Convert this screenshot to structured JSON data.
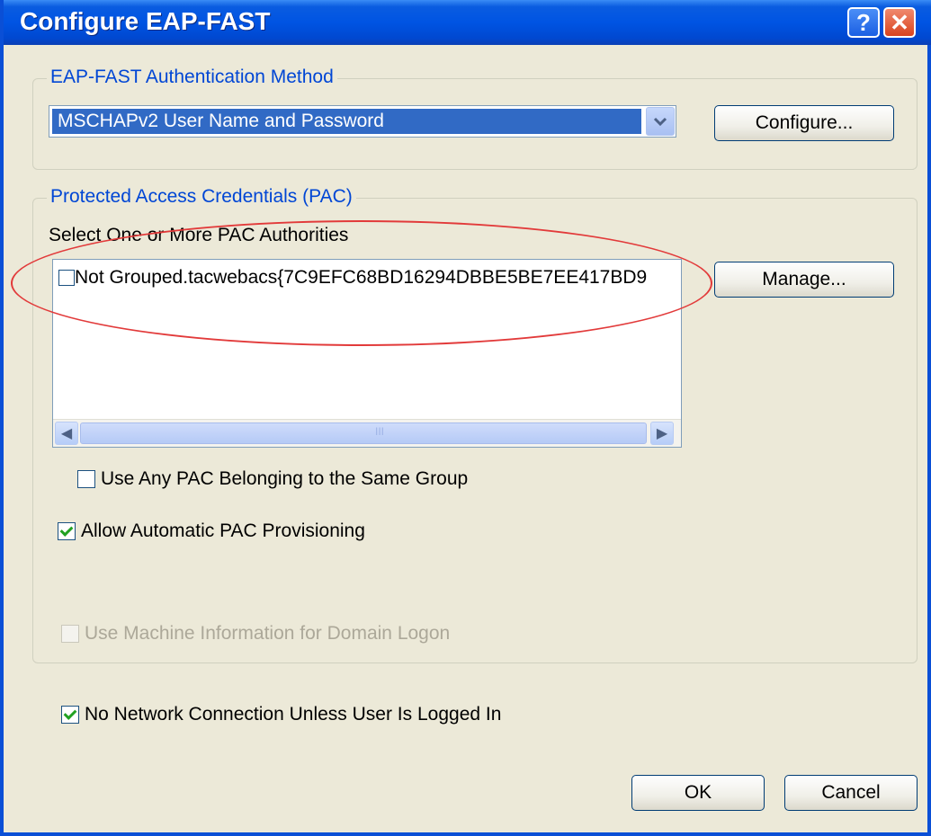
{
  "window": {
    "title": "Configure EAP-FAST",
    "help_icon": "help-icon",
    "close_icon": "close-icon"
  },
  "auth_group": {
    "legend": "EAP-FAST Authentication Method",
    "selected_method": "MSCHAPv2 User Name and Password",
    "configure_button": "Configure..."
  },
  "pac_group": {
    "legend": "Protected Access Credentials (PAC)",
    "select_label": "Select One or More PAC Authorities",
    "pac_items": [
      {
        "label": "Not Grouped.tacwebacs{7C9EFC68BD16294DBBE5BE7EE417BD9",
        "checked": false
      }
    ],
    "manage_button": "Manage...",
    "scroll_thumb_grip": "III",
    "use_any_pac": {
      "label": "Use Any PAC Belonging to the Same Group",
      "checked": false
    },
    "allow_provisioning": {
      "label": "Allow Automatic PAC Provisioning",
      "checked": true
    },
    "use_machine_info": {
      "label": "Use Machine Information for Domain Logon",
      "checked": false,
      "enabled": false
    }
  },
  "no_network": {
    "label": "No Network Connection Unless User Is Logged In",
    "checked": true
  },
  "buttons": {
    "ok": "OK",
    "cancel": "Cancel"
  },
  "colors": {
    "titlebar": "#0054e3",
    "legend": "#0046d5",
    "annotation_ellipse": "#e23a3a"
  }
}
